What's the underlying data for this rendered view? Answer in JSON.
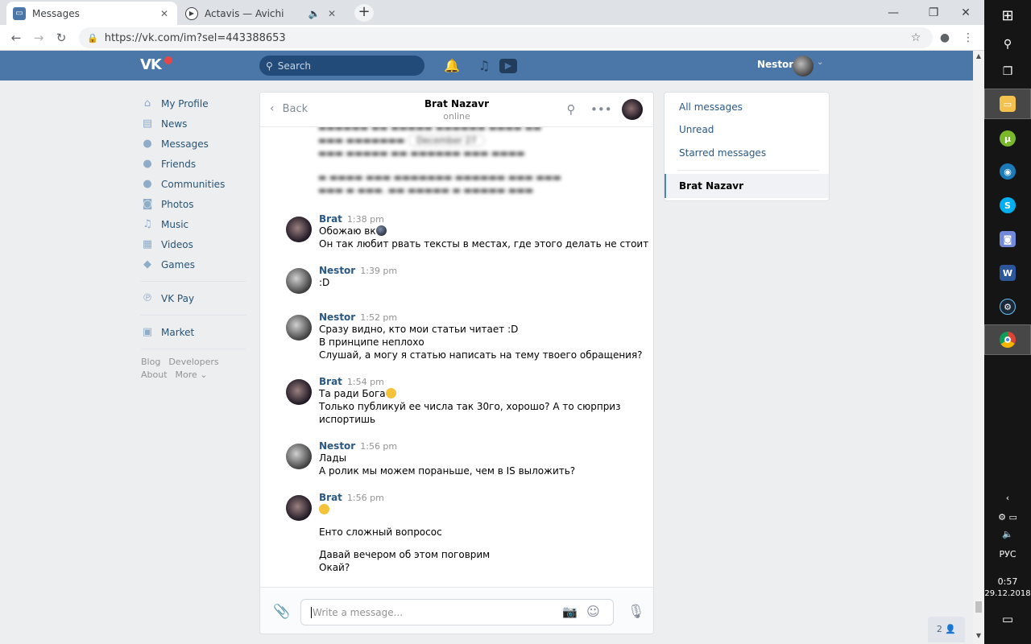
{
  "browser": {
    "tabs": [
      {
        "title": "Messages",
        "favicon": "vk-messages-icon",
        "close": "✕"
      },
      {
        "title": "Actavis — Avichi",
        "favicon": "youtube-play-icon",
        "audio": "speaker-icon",
        "close": "✕"
      }
    ],
    "new_tab": "+",
    "window_controls": {
      "minimize": "—",
      "maximize": "❐",
      "close": "✕"
    },
    "url": "https://vk.com/im?sel=443388653",
    "nav": {
      "back": "←",
      "forward": "→",
      "reload": "↻"
    },
    "toolbar_icons": {
      "star": "☆",
      "account": "●",
      "menu": "⋮"
    }
  },
  "vk_header": {
    "logo": "VK",
    "search_placeholder": "Search",
    "user_name": "Nestor",
    "icons": [
      "bell-icon",
      "music-icon",
      "video-icon"
    ]
  },
  "left_nav": {
    "items": [
      {
        "label": "My Profile",
        "icon": "⌂"
      },
      {
        "label": "News",
        "icon": "▤"
      },
      {
        "label": "Messages",
        "icon": "●"
      },
      {
        "label": "Friends",
        "icon": "●"
      },
      {
        "label": "Communities",
        "icon": "●"
      },
      {
        "label": "Photos",
        "icon": "◙"
      },
      {
        "label": "Music",
        "icon": "♫"
      },
      {
        "label": "Videos",
        "icon": "▦"
      },
      {
        "label": "Games",
        "icon": "◆"
      }
    ],
    "vkpay": {
      "label": "VK Pay",
      "icon": "℗"
    },
    "market": {
      "label": "Market",
      "icon": "▣"
    },
    "footer": {
      "blog": "Blog",
      "developers": "Developers",
      "about": "About",
      "more": "More ⌄"
    }
  },
  "chat": {
    "back_label": "Back",
    "peer_name": "Brat Nazavr",
    "peer_status": "online",
    "date_badge": "December 27",
    "messages": [
      {
        "author": "Brat",
        "time": "1:38 pm",
        "avatar": "brat",
        "lines": [
          "Обожаю вк",
          "Он так любит рвать тексты в местах, где этого делать не стоит"
        ]
      },
      {
        "author": "Nestor",
        "time": "1:39 pm",
        "avatar": "nestor",
        "lines": [
          ":D"
        ]
      },
      {
        "author": "Nestor",
        "time": "1:52 pm",
        "avatar": "nestor",
        "lines": [
          "Сразу видно, кто мои статьи читает :D",
          "В принципе неплохо",
          "Слушай, а могу я статью написать на тему твоего обращения?"
        ]
      },
      {
        "author": "Brat",
        "time": "1:54 pm",
        "avatar": "brat",
        "lines": [
          "Та ради Бога",
          "Только публикуй ее числа так 30го, хорошо? А то сюрприз",
          "испортишь"
        ]
      },
      {
        "author": "Nestor",
        "time": "1:56 pm",
        "avatar": "nestor",
        "lines": [
          "Лады",
          "А ролик мы можем пораньше, чем в IS выложить?"
        ]
      },
      {
        "author": "Brat",
        "time": "1:56 pm",
        "avatar": "brat",
        "lines": [
          "",
          "",
          "Енто сложный вопросос",
          "",
          "Давай вечером об этом поговрим",
          "Окай?"
        ]
      }
    ],
    "composer_placeholder": "Write a message..."
  },
  "right_menu": {
    "all_messages": "All messages",
    "unread": "Unread",
    "starred": "Starred messages",
    "selected": "Brat Nazavr"
  },
  "friends_online": "2 👤",
  "taskbar": {
    "lang": "РУС",
    "time": "0:57",
    "date": "29.12.2018",
    "apps": [
      {
        "name": "file-explorer-icon",
        "color": "#f2c14e"
      },
      {
        "name": "utorrent-icon",
        "color": "#78b82a"
      },
      {
        "name": "app-icon",
        "color": "#1a7bb8"
      },
      {
        "name": "skype-icon",
        "color": "#00aff0"
      },
      {
        "name": "discord-icon",
        "color": "#7289da"
      },
      {
        "name": "word-icon",
        "color": "#2b579a"
      },
      {
        "name": "steam-icon",
        "color": "#1b2838"
      },
      {
        "name": "chrome-icon",
        "color": "#db4437"
      }
    ]
  },
  "colors": {
    "vk_blue": "#4a76a8",
    "link": "#2a5885",
    "bg": "#edeef0"
  }
}
